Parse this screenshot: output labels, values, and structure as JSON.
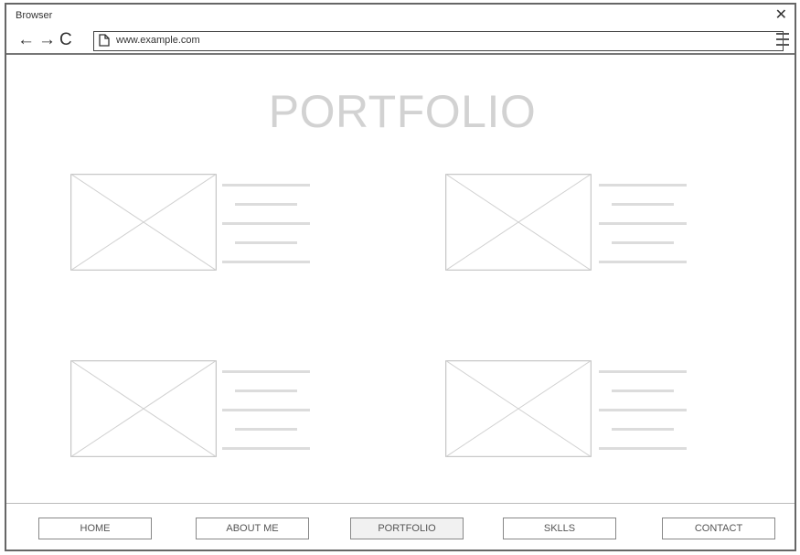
{
  "browser": {
    "title": "Browser",
    "url": "www.example.com",
    "nav_icons": [
      "back-arrow-icon",
      "forward-arrow-icon",
      "reload-icon"
    ]
  },
  "page": {
    "title": "PORTFOLIO",
    "cards_count_visible": 4
  },
  "footer": {
    "buttons": [
      {
        "label": "HOME",
        "active": false
      },
      {
        "label": "ABOUT ME",
        "active": false
      },
      {
        "label": "PORTFOLIO",
        "active": true
      },
      {
        "label": "SKLLS",
        "active": false
      },
      {
        "label": "CONTACT",
        "active": false
      }
    ]
  }
}
